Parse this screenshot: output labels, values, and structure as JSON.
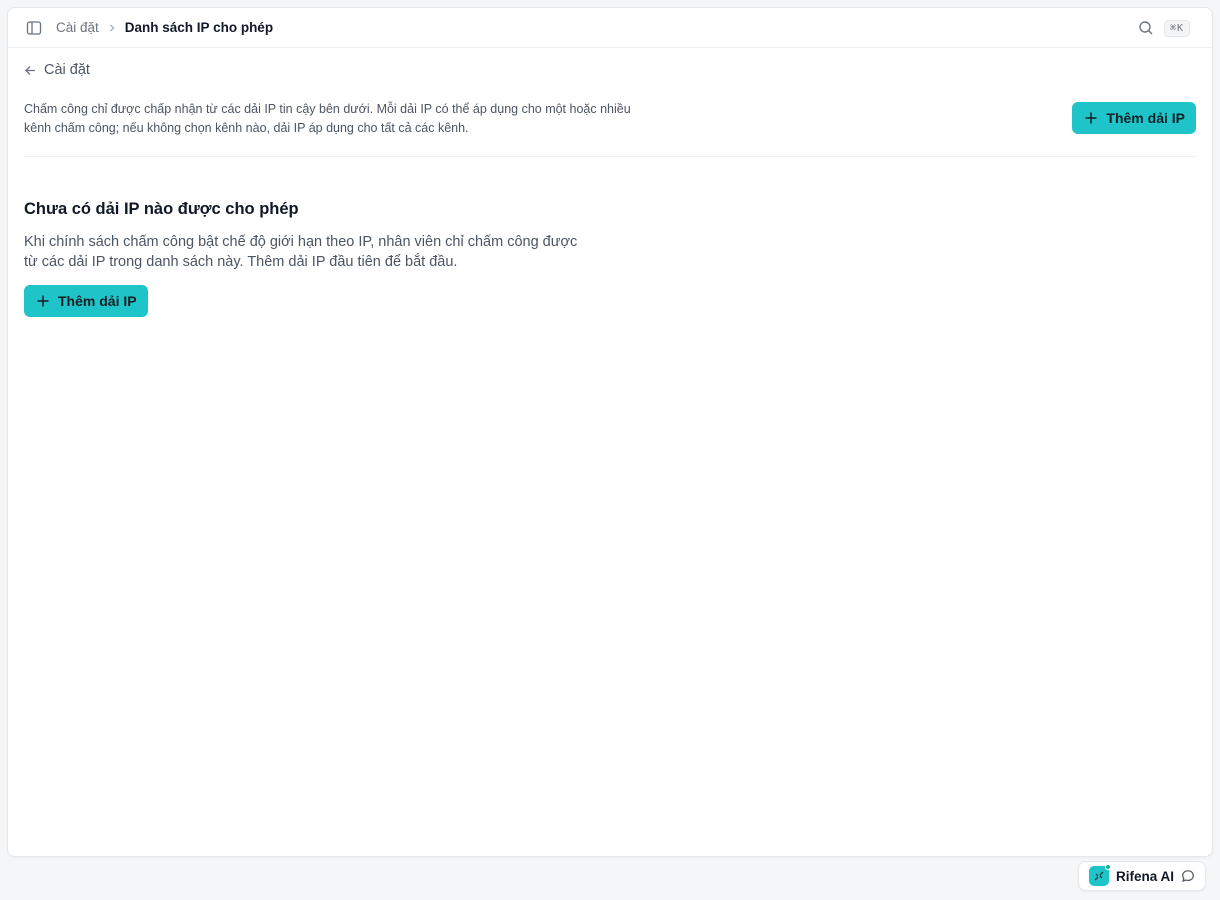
{
  "topbar": {
    "sidebar_toggle_icon": "sidebar-toggle-icon",
    "breadcrumb_parent": "Cài đặt",
    "breadcrumb_current": "Danh sách IP cho phép",
    "search_icon": "search-icon",
    "shortcut": "⌘K"
  },
  "back_link": {
    "label": "Cài đặt",
    "icon": "arrow-left-icon"
  },
  "header": {
    "description_line1": "Chấm công chỉ được chấp nhận từ các dải IP tin cậy bên dưới. Mỗi dải IP có thể áp dụng cho một hoặc nhiều",
    "description_line2": "kênh chấm công; nếu không chọn kênh nào, dải IP áp dụng cho tất cả các kênh.",
    "add_button_label": "Thêm dải IP"
  },
  "empty_state": {
    "title": "Chưa có dải IP nào được cho phép",
    "description_line1": "Khi chính sách chấm công bật chế độ giới hạn theo IP, nhân viên chỉ chấm công được",
    "description_line2": "từ các dải IP trong danh sách này. Thêm dải IP đầu tiên để bắt đầu.",
    "add_button_label": "Thêm dải IP"
  },
  "assistant": {
    "label": "Rifena AI",
    "icon": "chat-bubble-icon"
  },
  "colors": {
    "accent": "#1fc4c8",
    "background": "#f4f6f8",
    "text_muted": "#4b5563"
  }
}
